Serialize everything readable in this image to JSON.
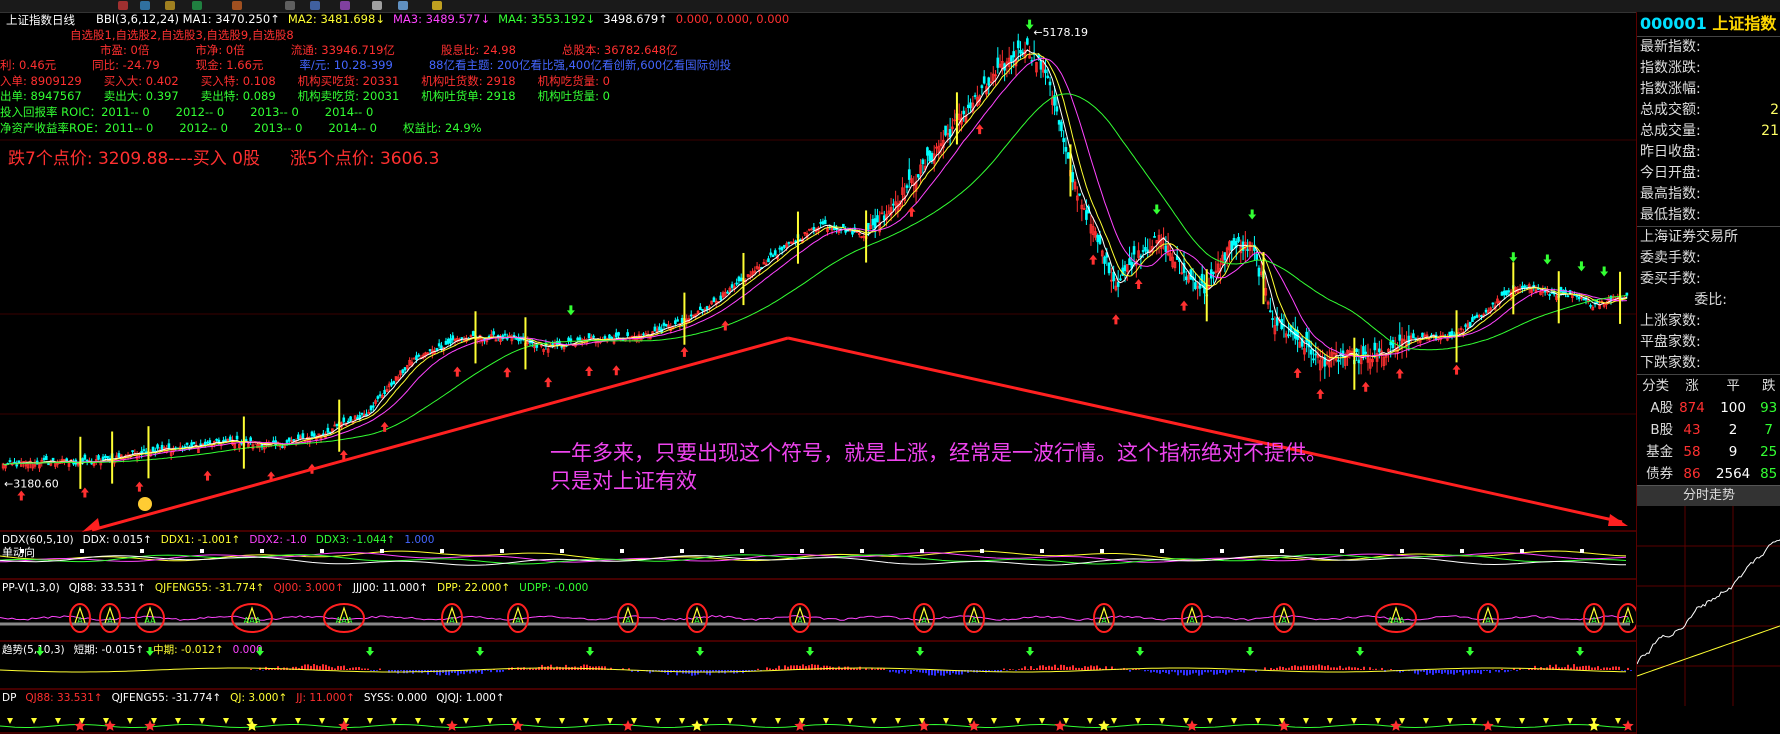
{
  "colors": {
    "red": "#ff3030",
    "green": "#33ff33",
    "yellow": "#ffff33",
    "white": "#ffffff",
    "magenta": "#ff44ff",
    "cyan": "#00ffff",
    "orange": "#ffaa00"
  },
  "header": {
    "index_name": "上证指数日线",
    "line1": [
      {
        "text": "BBI(3,6,12,24) MA1: 3470.250↑",
        "color": "#ffffff"
      },
      {
        "text": "MA2: 3481.698↓",
        "color": "#ffff33"
      },
      {
        "text": "MA3: 3489.577↓",
        "color": "#ff44ff"
      },
      {
        "text": "MA4: 3553.192↓",
        "color": "#33ff33"
      },
      {
        "text": "3498.679↑",
        "color": "#ffffff"
      },
      {
        "text": "0.000, 0.000, 0.000",
        "color": "#ff3030"
      }
    ],
    "line2": "自选股1,自选股2,自选股3,自选股9,自选股8",
    "line3": [
      {
        "text": "市盈: 0倍",
        "color": "#ff3030"
      },
      {
        "text": "市净: 0倍",
        "color": "#ff3030"
      },
      {
        "text": "流通: 33946.719亿",
        "color": "#ff3030"
      },
      {
        "text": "股息比: 24.98",
        "color": "#ff3030"
      },
      {
        "text": "总股本: 36782.648亿",
        "color": "#ff3030"
      }
    ],
    "line4": [
      {
        "text": "利: 0.46元",
        "color": "#ff3030"
      },
      {
        "text": "同比: -24.79",
        "color": "#ff3030"
      },
      {
        "text": "现金: 1.66元",
        "color": "#ff3030"
      },
      {
        "text": "率/元: 10.28-399",
        "color": "#4466ff"
      },
      {
        "text": "88亿看主题: 200亿看比强,400亿看创新,600亿看国际创投",
        "color": "#4466ff"
      }
    ],
    "line5": [
      {
        "text": "入单: 8909129",
        "color": "#ff3030"
      },
      {
        "text": "买入大: 0.402",
        "color": "#ff3030"
      },
      {
        "text": "买入特: 0.108",
        "color": "#ff3030"
      },
      {
        "text": "机构买吃货: 20331",
        "color": "#ff3030"
      },
      {
        "text": "机构吐货数: 2918",
        "color": "#ff3030"
      },
      {
        "text": "机构吃货量: 0",
        "color": "#ff3030"
      }
    ],
    "line6": [
      {
        "text": "出单: 8947567",
        "color": "#33ff33"
      },
      {
        "text": "卖出大: 0.397",
        "color": "#33ff33"
      },
      {
        "text": "卖出特: 0.089",
        "color": "#33ff33"
      },
      {
        "text": "机构卖吃货: 20031",
        "color": "#33ff33"
      },
      {
        "text": "机构吐货单: 2918",
        "color": "#33ff33"
      },
      {
        "text": "机构吐货量: 0",
        "color": "#33ff33"
      }
    ],
    "line7": [
      {
        "text": "投入回报率 ROIC：2011-- 0",
        "color": "#33ff33"
      },
      {
        "text": "2012-- 0",
        "color": "#33ff33"
      },
      {
        "text": "2013-- 0",
        "color": "#33ff33"
      },
      {
        "text": "2014-- 0",
        "color": "#33ff33"
      }
    ],
    "line8": [
      {
        "text": "净资产收益率ROE：2011-- 0",
        "color": "#33ff33"
      },
      {
        "text": "2012-- 0",
        "color": "#33ff33"
      },
      {
        "text": "2013-- 0",
        "color": "#33ff33"
      },
      {
        "text": "2014-- 0",
        "color": "#33ff33"
      },
      {
        "text": "权益比: 24.9%",
        "color": "#33ff33"
      }
    ],
    "line9": [
      {
        "text": "跌7个点价: 3209.88----买入 0股",
        "color": "#ff3030"
      },
      {
        "text": "涨5个点价: 3606.3",
        "color": "#ff3030"
      }
    ]
  },
  "annotation": {
    "line1": "一年多来，只要出现这个符号，就是上涨，经常是一波行情。这个指标绝对不提供。",
    "line2": "只是对上证有效"
  },
  "chart_data": {
    "type": "candlestick",
    "title": "上证指数日线",
    "y_range": [
      2980,
      5250
    ],
    "labels": {
      "high": "5178.19",
      "low": "3180.60"
    },
    "close_anchors": [
      [
        0,
        3220
      ],
      [
        20,
        3235
      ],
      [
        40,
        3232
      ],
      [
        60,
        3280
      ],
      [
        80,
        3300
      ],
      [
        100,
        3330
      ],
      [
        120,
        3310
      ],
      [
        140,
        3360
      ],
      [
        160,
        3460
      ],
      [
        180,
        3700
      ],
      [
        200,
        3800
      ],
      [
        220,
        3810
      ],
      [
        240,
        3760
      ],
      [
        260,
        3800
      ],
      [
        280,
        3810
      ],
      [
        300,
        3880
      ],
      [
        320,
        4020
      ],
      [
        340,
        4190
      ],
      [
        360,
        4330
      ],
      [
        380,
        4280
      ],
      [
        400,
        4520
      ],
      [
        420,
        4800
      ],
      [
        440,
        5050
      ],
      [
        450,
        5150
      ],
      [
        460,
        5020
      ],
      [
        470,
        4560
      ],
      [
        480,
        4300
      ],
      [
        490,
        4050
      ],
      [
        500,
        4200
      ],
      [
        510,
        4260
      ],
      [
        520,
        4100
      ],
      [
        530,
        4020
      ],
      [
        540,
        4230
      ],
      [
        550,
        4220
      ],
      [
        560,
        3880
      ],
      [
        570,
        3800
      ],
      [
        580,
        3700
      ],
      [
        590,
        3720
      ],
      [
        600,
        3710
      ],
      [
        610,
        3740
      ],
      [
        620,
        3800
      ],
      [
        640,
        3820
      ],
      [
        650,
        3900
      ],
      [
        660,
        3990
      ],
      [
        670,
        4050
      ],
      [
        680,
        4010
      ],
      [
        690,
        4000
      ],
      [
        700,
        3960
      ],
      [
        710,
        3990
      ]
    ],
    "bars": 716,
    "ma_periods": [
      5,
      10,
      20,
      60
    ],
    "ma_colors": [
      "#ffffff",
      "#ffff33",
      "#ff44ff",
      "#33ff33"
    ],
    "up_color": "#ff3030",
    "down_color": "#00ffff",
    "signal_bars": [
      34,
      48,
      64,
      106,
      148,
      208,
      230,
      300,
      326,
      350,
      380,
      420,
      470,
      530,
      555,
      595,
      640,
      665,
      685,
      712
    ],
    "up_arrow_bars": [
      8,
      36,
      60,
      90,
      118,
      136,
      150,
      168,
      200,
      222,
      240,
      258,
      270,
      300,
      318,
      400,
      430,
      480,
      490,
      500,
      520,
      570,
      580,
      600,
      615,
      640
    ],
    "down_arrow_bars": [
      250,
      452,
      508,
      550,
      665,
      680,
      695,
      705
    ],
    "arrow": {
      "apex": [
        348,
        338
      ],
      "left_end": [
        22,
        530
      ],
      "right_end": [
        1622,
        522
      ]
    }
  },
  "sub_indicators": [
    {
      "id": "ddx",
      "title_parts": [
        {
          "text": "DDX(60,5,10)",
          "color": "#ffffff"
        },
        {
          "text": "DDX: 0.015↑",
          "color": "#ffffff"
        },
        {
          "text": "DDX1: -1.001↑",
          "color": "#ffff33"
        },
        {
          "text": "DDX2: -1.0",
          "color": "#ff44ff"
        },
        {
          "text": "DDX3: -1.044↑",
          "color": "#33ff33"
        },
        {
          "text": "1.000",
          "color": "#4466ff"
        }
      ],
      "caption": "单动向"
    },
    {
      "id": "ppv",
      "title_parts": [
        {
          "text": "PP-V(1,3,0)",
          "color": "#ffffff"
        },
        {
          "text": "QJ88: 33.531↑",
          "color": "#ffffff"
        },
        {
          "text": "QJFENG55: -31.774↑",
          "color": "#ffff33"
        },
        {
          "text": "QJ00: 3.000↑",
          "color": "#ff3030"
        },
        {
          "text": "JJJ00: 11.000↑",
          "color": "#ffffff"
        },
        {
          "text": "DPP: 22.000↑",
          "color": "#ffff33"
        },
        {
          "text": "UDPP: -0.000",
          "color": "#33ff33"
        }
      ],
      "circles": [
        {
          "x": 80,
          "label": "A"
        },
        {
          "x": 110,
          "label": "A"
        },
        {
          "x": 150,
          "label": "AA"
        },
        {
          "x": 252,
          "label": "AAA"
        },
        {
          "x": 344,
          "label": "AAA"
        },
        {
          "x": 452,
          "label": "A"
        },
        {
          "x": 518,
          "label": "A"
        },
        {
          "x": 628,
          "label": "A"
        },
        {
          "x": 697,
          "label": "A"
        },
        {
          "x": 800,
          "label": "A"
        },
        {
          "x": 924,
          "label": "A"
        },
        {
          "x": 974,
          "label": "A"
        },
        {
          "x": 1104,
          "label": "A"
        },
        {
          "x": 1192,
          "label": "A"
        },
        {
          "x": 1284,
          "label": "A"
        },
        {
          "x": 1396,
          "label": "AAA"
        },
        {
          "x": 1488,
          "label": "A"
        },
        {
          "x": 1594,
          "label": "A"
        },
        {
          "x": 1628,
          "label": "A"
        }
      ]
    },
    {
      "id": "trend",
      "title_parts": [
        {
          "text": "趋势(5,10,3)",
          "color": "#ffffff"
        },
        {
          "text": "短期: -0.015↑",
          "color": "#ffffff"
        },
        {
          "text": "中期: -0.012↑",
          "color": "#ffff33"
        },
        {
          "text": "0.000",
          "color": "#ff44ff"
        }
      ]
    },
    {
      "id": "dp",
      "title_parts": [
        {
          "text": "DP",
          "color": "#ffffff"
        },
        {
          "text": "QJ88: 33.531↑",
          "color": "#ff3030"
        },
        {
          "text": "QJFENG55: -31.774↑",
          "color": "#ffffff"
        },
        {
          "text": "QJ: 3.000↑",
          "color": "#ffff33"
        },
        {
          "text": "JJ: 11.000↑",
          "color": "#ff3030"
        },
        {
          "text": "SYSS: 0.000",
          "color": "#ffffff"
        },
        {
          "text": "QJQJ: 1.000↑",
          "color": "#ffffff"
        }
      ]
    }
  ],
  "sidebar": {
    "code": "000001",
    "name": "上证指数",
    "fields": [
      {
        "label": "最新指数:",
        "value": ""
      },
      {
        "label": "指数涨跌:",
        "value": ""
      },
      {
        "label": "指数涨幅:",
        "value": ""
      },
      {
        "label": "总成交额:",
        "value": "2"
      },
      {
        "label": "总成交量:",
        "value": "21"
      },
      {
        "label": "昨日收盘:",
        "value": ""
      },
      {
        "label": "今日开盘:",
        "value": ""
      },
      {
        "label": "最高指数:",
        "value": ""
      },
      {
        "label": "最低指数:",
        "value": ""
      }
    ],
    "exchange": "上海证券交易所",
    "fields2": [
      {
        "label": "委卖手数:",
        "value": ""
      },
      {
        "label": "委买手数:",
        "value": ""
      },
      {
        "label": "委比:",
        "value": "",
        "right": true
      },
      {
        "label": "上涨家数:",
        "value": ""
      },
      {
        "label": "平盘家数:",
        "value": ""
      },
      {
        "label": "下跌家数:",
        "value": ""
      }
    ],
    "table_headers": [
      "分类",
      "涨",
      "平",
      "跌"
    ],
    "table_rows": [
      [
        "A股",
        "874",
        "100",
        "93"
      ],
      [
        "B股",
        "43",
        "2",
        "7"
      ],
      [
        "基金",
        "58",
        "9",
        "25"
      ],
      [
        "债券",
        "86",
        "2564",
        "85"
      ]
    ],
    "button": "分时走势"
  }
}
